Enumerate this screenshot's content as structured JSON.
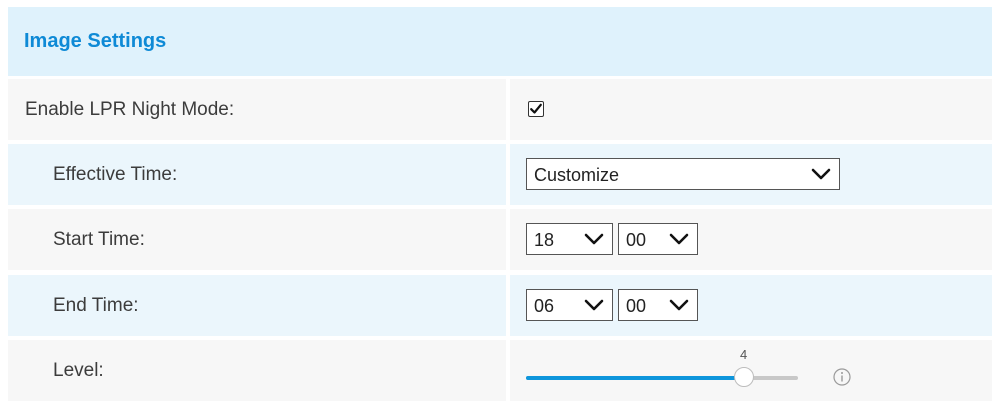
{
  "header": {
    "title": "Image Settings"
  },
  "night_mode": {
    "label": "Enable LPR Night Mode:",
    "checked": true
  },
  "effective_time": {
    "label": "Effective Time:",
    "value": "Customize"
  },
  "start_time": {
    "label": "Start Time:",
    "hour": "18",
    "minute": "00"
  },
  "end_time": {
    "label": "End Time:",
    "hour": "06",
    "minute": "00"
  },
  "level": {
    "label": "Level:",
    "value": "4",
    "min": 0,
    "max": 5
  },
  "icons": {
    "check": "checkmark-icon",
    "chevron": "chevron-down-icon",
    "info": "info-icon"
  },
  "colors": {
    "accent": "#0e96dc",
    "header_bg": "#dff2fc",
    "title": "#0e8ad6"
  }
}
